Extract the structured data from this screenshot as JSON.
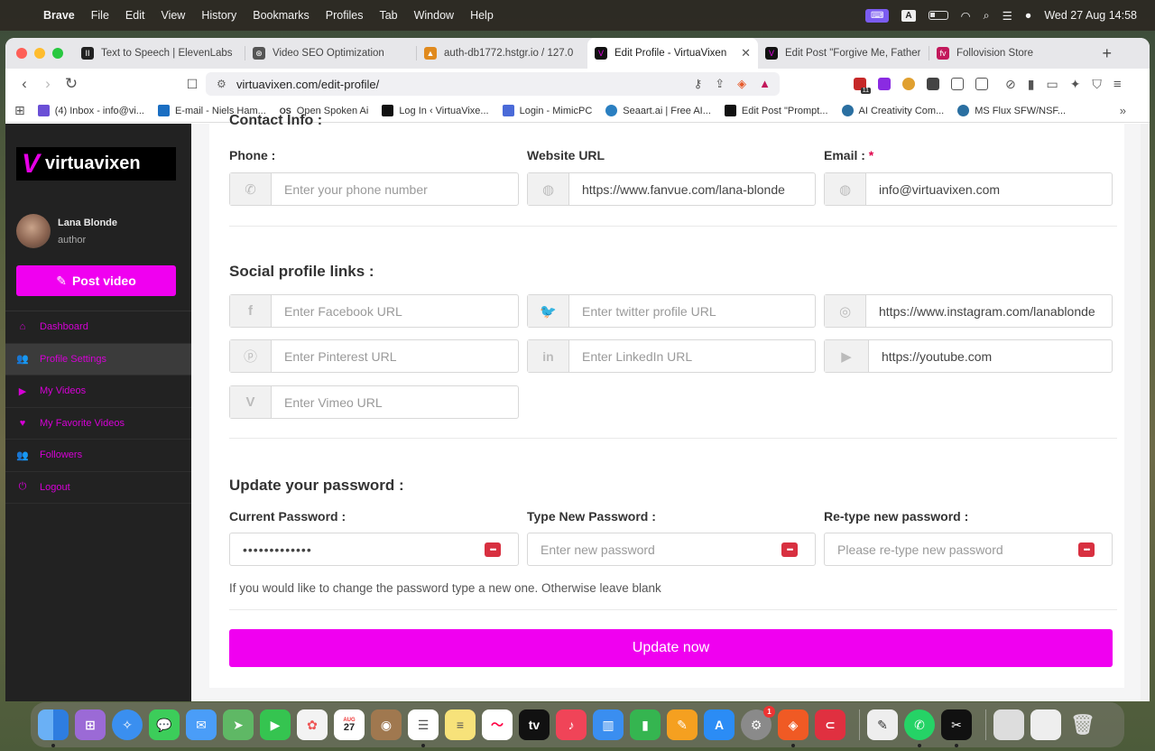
{
  "menubar": {
    "app_name": "Brave",
    "items": [
      "File",
      "Edit",
      "View",
      "History",
      "Bookmarks",
      "Profiles",
      "Tab",
      "Window",
      "Help"
    ],
    "clock": "Wed 27 Aug  14:58",
    "input_indicator": "A"
  },
  "browser": {
    "tabs": [
      {
        "title": "Text to Speech | ElevenLabs",
        "fav_color": "#222222",
        "fav_glyph": "II"
      },
      {
        "title": "Video SEO Optimization",
        "fav_color": "#555555",
        "fav_glyph": "⊛"
      },
      {
        "title": "auth-db1772.hstgr.io / 127.0",
        "fav_color": "#e08a1e",
        "fav_glyph": "▲"
      },
      {
        "title": "Edit Profile - VirtuaVixen",
        "fav_color": "#111111",
        "fav_glyph": "V",
        "active": true
      },
      {
        "title": "Edit Post \"Forgive Me, Father",
        "fav_color": "#111111",
        "fav_glyph": "V"
      },
      {
        "title": "Follovision Store",
        "fav_color": "#c2185b",
        "fav_glyph": "fv"
      }
    ],
    "url": "virtuavixen.com/edit-profile/",
    "ext_badge": "11",
    "bookmarks": [
      {
        "label": "(4) Inbox - info@vi...",
        "color": "#6a4fd6"
      },
      {
        "label": "E-mail - Niels Ham...",
        "color": "#1a6ec2"
      },
      {
        "label": "Open Spoken Ai",
        "color": "#333333",
        "glyph": "OS"
      },
      {
        "label": "Log In ‹ VirtuaVixe...",
        "color": "#111111"
      },
      {
        "label": "Login - MimicPC",
        "color": "#4a6ad8"
      },
      {
        "label": "Seaart.ai | Free AI...",
        "color": "#2a7fc1"
      },
      {
        "label": "Edit Post \"Prompt...",
        "color": "#111111"
      },
      {
        "label": "AI Creativity Com...",
        "color": "#2a6fa1"
      },
      {
        "label": "MS Flux SFW/NSF...",
        "color": "#2a6fa1"
      }
    ]
  },
  "sidebar": {
    "logo_text": "virtuavixen",
    "user_name": "Lana Blonde",
    "user_role": "author",
    "post_button": "Post video",
    "menu": [
      {
        "label": "Dashboard",
        "icon": "⌂"
      },
      {
        "label": "Profile Settings",
        "icon": "👥",
        "active": true
      },
      {
        "label": "My Videos",
        "icon": "▶"
      },
      {
        "label": "My Favorite Videos",
        "icon": "♥"
      },
      {
        "label": "Followers",
        "icon": "👥"
      },
      {
        "label": "Logout",
        "icon": "⏻"
      }
    ]
  },
  "form": {
    "contact_heading": "Contact Info :",
    "phone_label": "Phone :",
    "phone_placeholder": "Enter your phone number",
    "website_label": "Website URL",
    "website_value": "https://www.fanvue.com/lana-blonde",
    "email_label": "Email :",
    "email_required": "*",
    "email_value": "info@virtuavixen.com",
    "social_heading": "Social profile links :",
    "facebook_placeholder": "Enter Facebook URL",
    "twitter_placeholder": "Enter twitter profile URL",
    "instagram_value": "https://www.instagram.com/lanablonde",
    "pinterest_placeholder": "Enter Pinterest URL",
    "linkedin_placeholder": "Enter LinkedIn URL",
    "youtube_value": "https://youtube.com",
    "vimeo_placeholder": "Enter Vimeo URL",
    "password_heading": "Update your password :",
    "current_pw_label": "Current Password :",
    "current_pw_value": "•••••••••••••",
    "new_pw_label": "Type New Password :",
    "new_pw_placeholder": "Enter new password",
    "retype_pw_label": "Re-type new password :",
    "retype_pw_placeholder": "Please re-type new password",
    "pw_hint": "If you would like to change the password type a new one. Otherwise leave blank",
    "update_button": "Update now"
  },
  "dock": {
    "calendar_month": "AUG",
    "calendar_day": "27",
    "settings_badge": "1"
  },
  "colors": {
    "accent": "#f000f0",
    "sidebar_bg": "#222222",
    "sidebar_link": "#d600d6"
  }
}
